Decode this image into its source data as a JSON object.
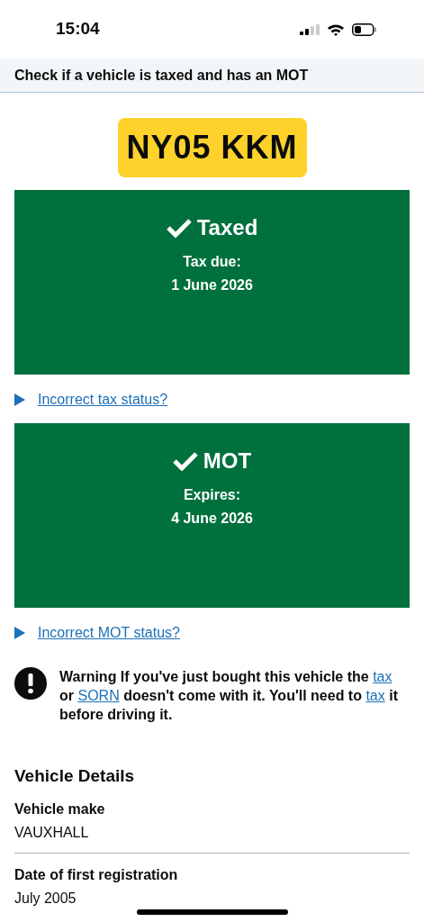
{
  "status_bar": {
    "time": "15:04"
  },
  "header": {
    "title": "Check if a vehicle is taxed and has an MOT"
  },
  "plate": "NY05 KKM",
  "statuses": [
    {
      "title": "Taxed",
      "ok": true,
      "label": "Tax due:",
      "date": "1 June 2026",
      "link": "Incorrect tax status?"
    },
    {
      "title": "MOT",
      "ok": true,
      "label": "Expires:",
      "date": "4 June 2026",
      "link": "Incorrect MOT status?"
    }
  ],
  "warning": {
    "segments": [
      {
        "kind": "text",
        "text": "Warning If you've just bought this vehicle the "
      },
      {
        "kind": "link",
        "text": "tax"
      },
      {
        "kind": "text",
        "text": " or "
      },
      {
        "kind": "link",
        "text": "SORN"
      },
      {
        "kind": "text",
        "text": " doesn't come with it. You'll need to "
      },
      {
        "kind": "link",
        "text": "tax"
      },
      {
        "kind": "text",
        "text": " it before driving it."
      }
    ]
  },
  "details": {
    "heading": "Vehicle Details",
    "rows": [
      {
        "label": "Vehicle make",
        "value": "VAUXHALL"
      },
      {
        "label": "Date of first registration",
        "value": "July 2005"
      }
    ]
  }
}
